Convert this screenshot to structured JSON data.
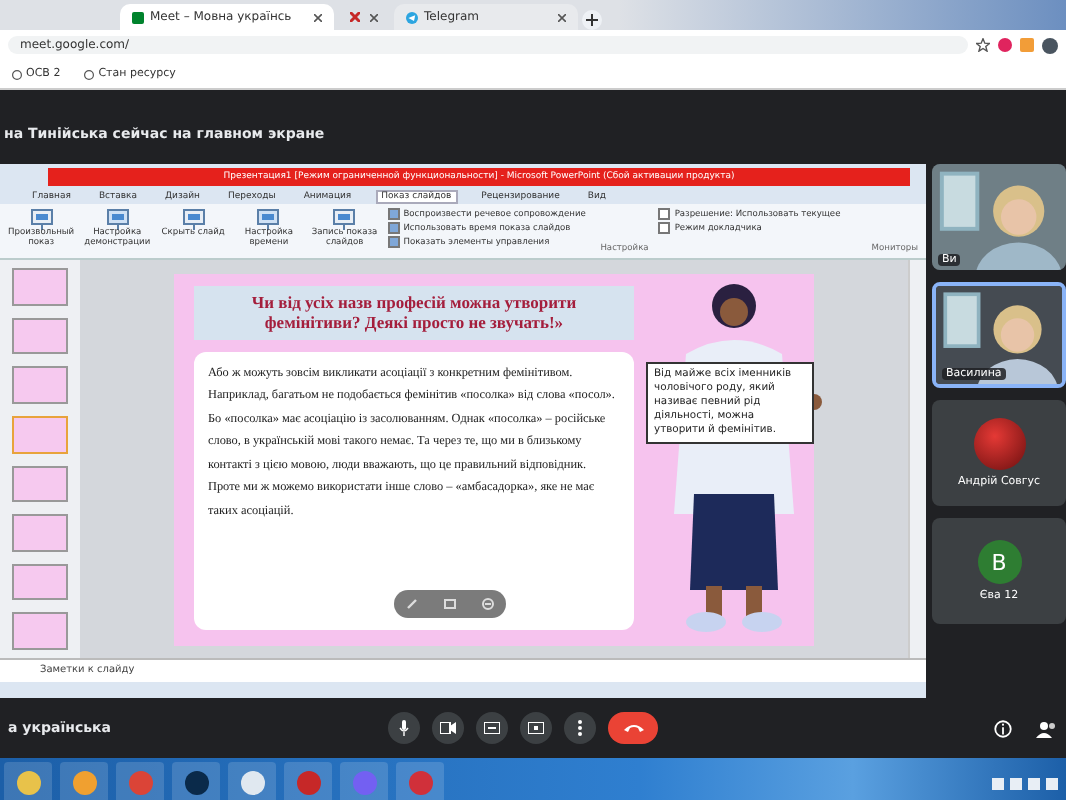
{
  "browser": {
    "tabs": [
      {
        "label": "Meet – Мовна українсь",
        "kind": "meet",
        "selected": true
      },
      {
        "kind": "pinned",
        "selected": false
      },
      {
        "label": "Telegram",
        "kind": "telegram",
        "selected": false
      }
    ],
    "url": "meet.google.com/",
    "bookmarks": [
      {
        "label": "ОСВ 2"
      },
      {
        "label": "Стан ресурсу"
      }
    ]
  },
  "meet": {
    "presenter_banner": "на Тинійська сейчас на главном экране",
    "meeting_name": "а українська",
    "participants": [
      {
        "name": "Ви",
        "kind": "video",
        "selected": false
      },
      {
        "name": "Василина",
        "kind": "video",
        "selected": true
      },
      {
        "name": "Андрій Совгус",
        "kind": "avatar",
        "selected": false
      },
      {
        "name": "Єва 12",
        "kind": "initial",
        "initial": "В",
        "color": "#2e7d32",
        "selected": false
      }
    ]
  },
  "powerpoint": {
    "title": "Презентация1 [Режим ограниченной функциональности] - Microsoft PowerPoint (Сбой активации продукта)",
    "tabs": [
      {
        "label": "Главная",
        "selected": false
      },
      {
        "label": "Вставка",
        "selected": false
      },
      {
        "label": "Дизайн",
        "selected": false
      },
      {
        "label": "Переходы",
        "selected": false
      },
      {
        "label": "Анимация",
        "selected": false
      },
      {
        "label": "Показ слайдов",
        "selected": true
      },
      {
        "label": "Рецензирование",
        "selected": false
      },
      {
        "label": "Вид",
        "selected": false
      }
    ],
    "buttons": [
      {
        "label": "Произвольный показ"
      },
      {
        "label": "Настройка демонстрации"
      },
      {
        "label": "Скрыть слайд"
      },
      {
        "label": "Настройка времени"
      },
      {
        "label": "Запись показа слайдов"
      }
    ],
    "options": [
      {
        "label": "Воспроизвести речевое сопровождение",
        "checked": true
      },
      {
        "label": "Использовать время показа слайдов",
        "checked": true
      },
      {
        "label": "Показать элементы управления",
        "checked": true
      }
    ],
    "monitor_options": [
      {
        "label": "Разрешение: Использовать текущее",
        "checked": false
      },
      {
        "label": "Режим докладчика",
        "checked": false
      }
    ],
    "groups": [
      "Настройка",
      "Мониторы"
    ],
    "slide": {
      "title": "Чи від усіх назв професій можна утворити фемінітиви? Деякі просто не звучать!»",
      "body": "Або ж можуть зовсім викликати асоціації з конкретним фемінітивом. Наприклад, багатьом не подобається фемінітив «посолка» від слова «посол». Бо «посолка» має асоціацію із засолюванням. Однак «посолка» – російське слово, в українській мові такого немає. Та через те, що ми в близькому контакті з цією мовою, люди вважають, що це правильний відповідник. Проте ми ж можемо використати інше слово – «амбасадорка», яке не має таких асоціацій.",
      "sign": "Від майже всіх іменників чоловічого роду, який називає певний рід діяльності, можна утворити й фемінітив."
    },
    "notes_placeholder": "Заметки к слайду"
  }
}
